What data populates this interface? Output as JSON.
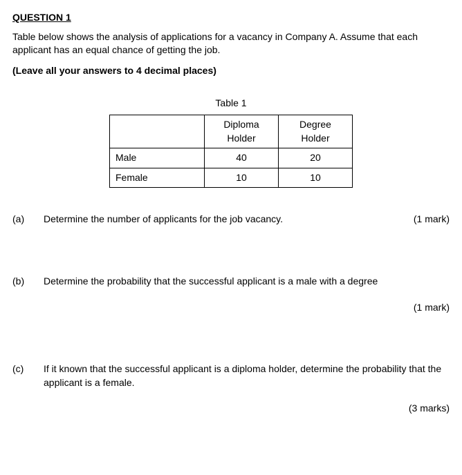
{
  "heading": "QUESTION 1",
  "intro": "Table below shows the analysis of applications for a vacancy in Company A. Assume that each applicant has an equal chance of getting the job.",
  "instruction": "(Leave all your answers to 4 decimal places)",
  "table": {
    "caption": "Table 1",
    "col_headers": [
      "Diploma Holder",
      "Degree Holder"
    ],
    "rows": [
      {
        "label": "Male",
        "values": [
          "40",
          "20"
        ]
      },
      {
        "label": "Female",
        "values": [
          "10",
          "10"
        ]
      }
    ]
  },
  "parts": {
    "a": {
      "label": "(a)",
      "text": "Determine the number of applicants for the job vacancy.",
      "marks": "(1 mark)"
    },
    "b": {
      "label": "(b)",
      "text": "Determine the probability that the successful applicant is a male with a degree",
      "marks": "(1 mark)"
    },
    "c": {
      "label": "(c)",
      "text": "If it known that the successful applicant is a diploma holder, determine the probability that the applicant is a female.",
      "marks": "(3 marks)"
    }
  }
}
